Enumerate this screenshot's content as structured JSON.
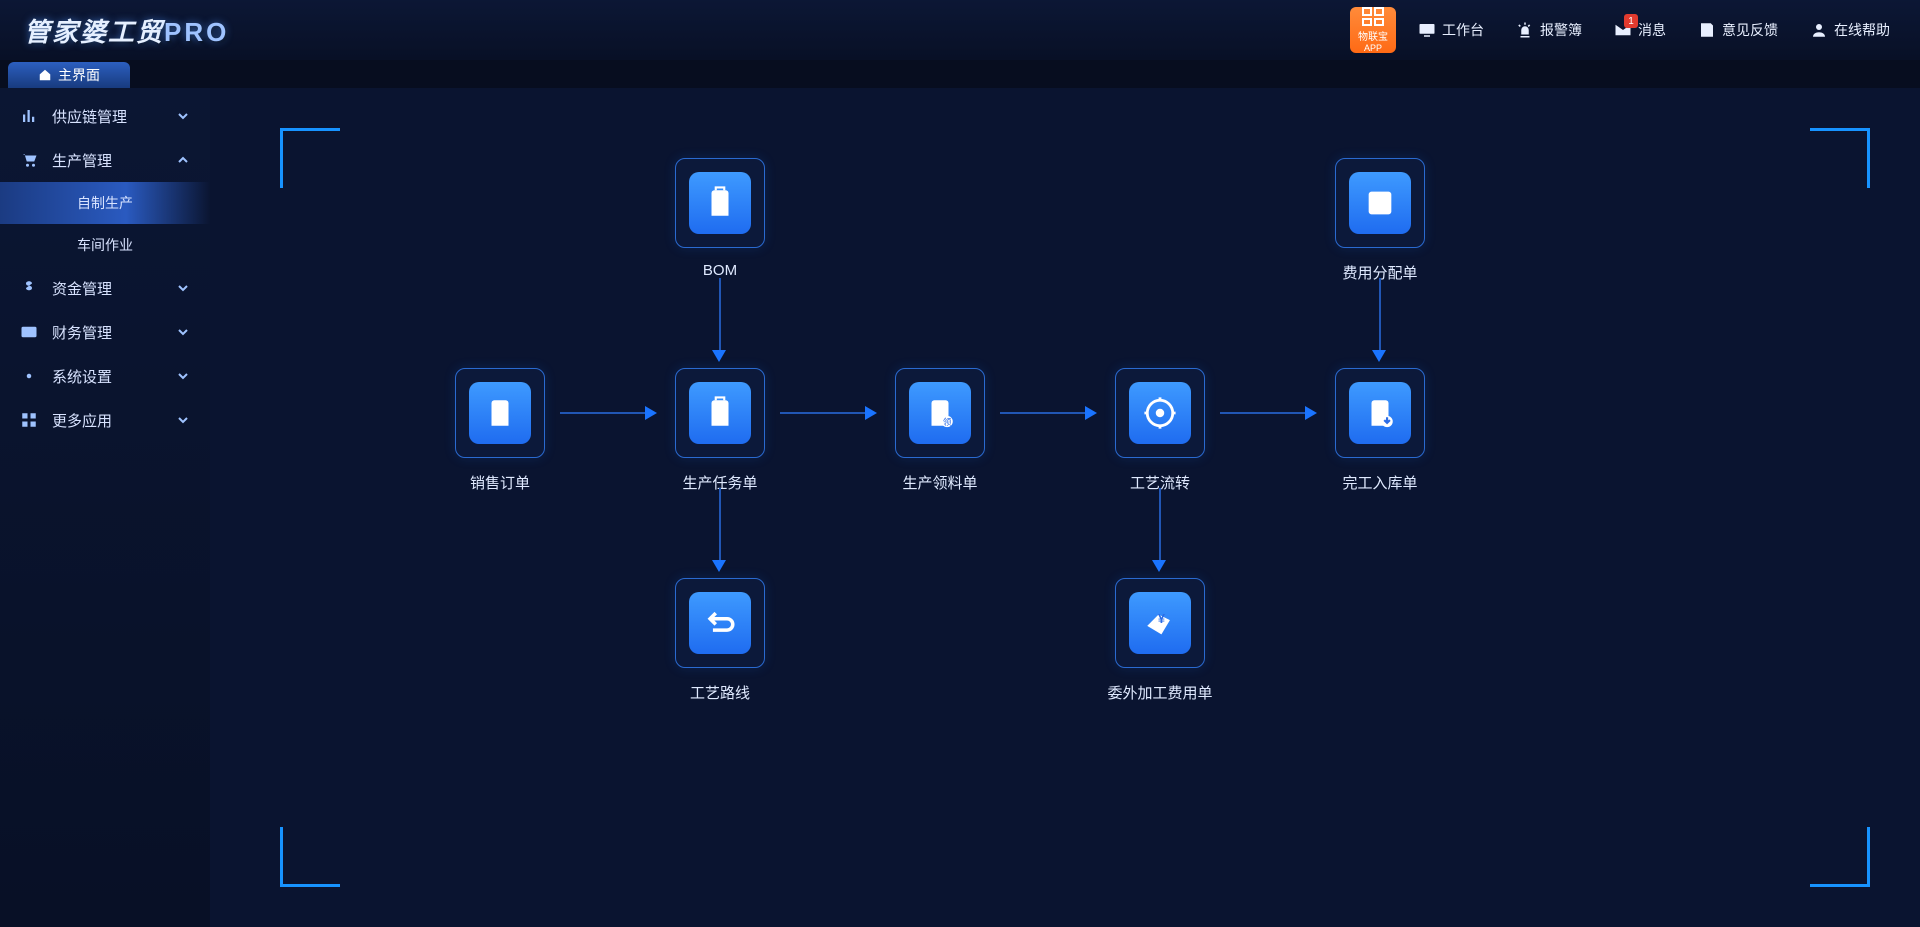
{
  "brand": {
    "name": "管家婆",
    "suffix": "工贸",
    "pro": "PRO"
  },
  "orange_button": {
    "label": "物联宝",
    "sub": "APP"
  },
  "topnav": [
    {
      "label": "工作台",
      "icon": "monitor"
    },
    {
      "label": "报警簿",
      "icon": "siren"
    },
    {
      "label": "消息",
      "icon": "mail",
      "badge": "1"
    },
    {
      "label": "意见反馈",
      "icon": "note"
    },
    {
      "label": "在线帮助",
      "icon": "user"
    }
  ],
  "tabs": [
    {
      "label": "主界面"
    }
  ],
  "sidebar": [
    {
      "label": "供应链管理",
      "icon": "chart",
      "expanded": false
    },
    {
      "label": "生产管理",
      "icon": "cart",
      "expanded": true,
      "children": [
        {
          "label": "自制生产",
          "active": true
        },
        {
          "label": "车间作业",
          "active": false
        }
      ]
    },
    {
      "label": "资金管理",
      "icon": "dollar",
      "expanded": false
    },
    {
      "label": "财务管理",
      "icon": "card",
      "expanded": false
    },
    {
      "label": "系统设置",
      "icon": "gear",
      "expanded": false
    },
    {
      "label": "更多应用",
      "icon": "grid",
      "expanded": false
    }
  ],
  "flow": {
    "nodes": {
      "bom": {
        "label": "BOM",
        "icon": "doc"
      },
      "sales": {
        "label": "销售订单",
        "icon": "download"
      },
      "task": {
        "label": "生产任务单",
        "icon": "doc"
      },
      "material": {
        "label": "生产领料单",
        "icon": "docbadge"
      },
      "process": {
        "label": "工艺流转",
        "icon": "gearcycle"
      },
      "finish": {
        "label": "完工入库单",
        "icon": "docdown"
      },
      "fee": {
        "label": "费用分配单",
        "icon": "share"
      },
      "route": {
        "label": "工艺路线",
        "icon": "return"
      },
      "outsrc": {
        "label": "委外加工费用单",
        "icon": "money"
      }
    }
  }
}
